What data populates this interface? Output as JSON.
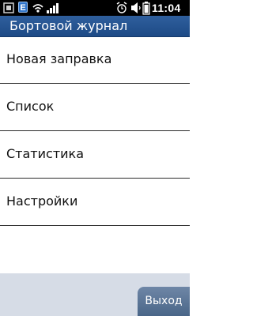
{
  "status_bar": {
    "e_badge": "E",
    "time": "11:04",
    "icons": [
      "app-icon",
      "edge-badge-icon",
      "wifi-icon",
      "signal-icon",
      "alarm-icon",
      "volume-icon",
      "battery-icon"
    ]
  },
  "header": {
    "title": "Бортовой журнал"
  },
  "menu": {
    "items": [
      {
        "label": "Новая заправка"
      },
      {
        "label": "Список"
      },
      {
        "label": "Статистика"
      },
      {
        "label": "Настройки"
      }
    ]
  },
  "softkeys": {
    "exit_label": "Выход"
  },
  "colors": {
    "title_bar": "#2f5f9d",
    "softkey_bar": "#d6dce6",
    "exit_button": "#5d779a",
    "edge_badge": "#2f74c9"
  }
}
